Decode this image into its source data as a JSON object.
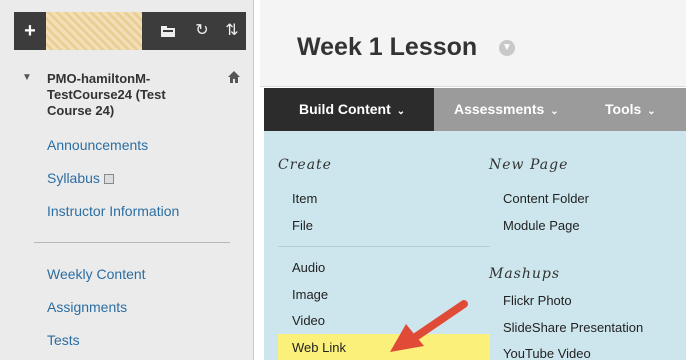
{
  "sidebar": {
    "toolbar": {
      "add": "+",
      "icons": [
        "folder-icon",
        "refresh-icon",
        "reorder-icon"
      ]
    },
    "course": {
      "title_line1": "PMO-hamiltonM-",
      "title_line2": "TestCourse24 (Test",
      "title_line3": "Course 24)"
    },
    "links": [
      {
        "label": "Announcements"
      },
      {
        "label": "Syllabus"
      },
      {
        "label": "Instructor Information"
      },
      {
        "label": "Weekly Content"
      },
      {
        "label": "Assignments"
      },
      {
        "label": "Tests"
      }
    ]
  },
  "content": {
    "title": "Week 1 Lesson",
    "nav": {
      "build_content": "Build Content",
      "assessments": "Assessments",
      "tools": "Tools"
    },
    "dropdown": {
      "create_heading": "Create",
      "create_items": [
        "Item",
        "File",
        "Audio",
        "Image",
        "Video",
        "Web Link"
      ],
      "new_page_heading": "New Page",
      "new_page_items": [
        "Content Folder",
        "Module Page"
      ],
      "mashups_heading": "Mashups",
      "mashups_items": [
        "Flickr Photo",
        "SlideShare Presentation",
        "YouTube Video"
      ]
    }
  },
  "colors": {
    "link": "#2c6ea2",
    "highlight": "#faf07a",
    "dropdown_bg": "#cde6ee",
    "arrow": "#e04b38"
  }
}
